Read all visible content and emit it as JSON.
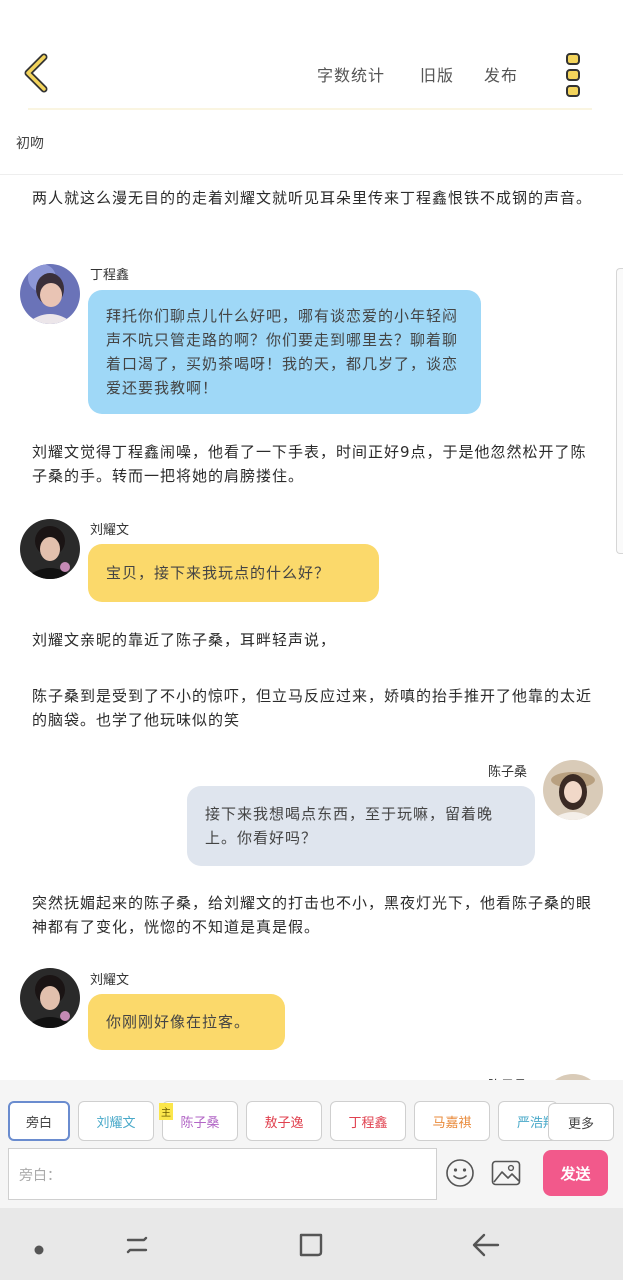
{
  "header": {
    "word_count_label": "字数统计",
    "old_version_label": "旧版",
    "publish_label": "发布"
  },
  "chapter_title": "初吻",
  "messages": [
    {
      "type": "narration",
      "text": "两人就这么漫无目的的走着刘耀文就听见耳朵里传来丁程鑫恨铁不成钢的声音。"
    },
    {
      "type": "dialogue",
      "speaker": "丁程鑫",
      "text": "拜托你们聊点儿什么好吧，哪有谈恋爱的小年轻闷声不吭只管走路的啊？你们要走到哪里去？聊着聊着口渴了，买奶茶喝呀！我的天，都几岁了，谈恋爱还要我教啊！"
    },
    {
      "type": "narration",
      "text": "刘耀文觉得丁程鑫闹噪，他看了一下手表，时间正好9点，于是他忽然松开了陈子桑的手。转而一把将她的肩膀搂住。"
    },
    {
      "type": "dialogue",
      "speaker": "刘耀文",
      "text": "宝贝，接下来我玩点的什么好？"
    },
    {
      "type": "narration",
      "text": "刘耀文亲昵的靠近了陈子桑，耳畔轻声说，"
    },
    {
      "type": "narration",
      "text": "陈子桑到是受到了不小的惊吓，但立马反应过来，娇嗔的抬手推开了他靠的太近的脑袋。也学了他玩味似的笑"
    },
    {
      "type": "dialogue",
      "speaker": "陈子桑",
      "text": "接下来我想喝点东西，至于玩嘛，留着晚上。你看好吗？"
    },
    {
      "type": "narration",
      "text": "突然抚媚起来的陈子桑，给刘耀文的打击也不小，黑夜灯光下，他看陈子桑的眼神都有了变化，恍惚的不知道是真是假。"
    },
    {
      "type": "dialogue",
      "speaker": "刘耀文",
      "text": "你刚刚好像在拉客。"
    },
    {
      "type": "dialogue",
      "speaker": "陈子桑",
      "text": ""
    }
  ],
  "roles": [
    {
      "label": "旁白",
      "color": "#444444",
      "active": true
    },
    {
      "label": "刘耀文",
      "color": "#49a9c9"
    },
    {
      "label": "陈子桑",
      "color": "#b266c6",
      "main_tag": "主"
    },
    {
      "label": "敖子逸",
      "color": "#e0414f"
    },
    {
      "label": "丁程鑫",
      "color": "#e0414f"
    },
    {
      "label": "马嘉祺",
      "color": "#e98a3a"
    },
    {
      "label": "严浩翔",
      "color": "#49a9c9"
    }
  ],
  "more_label": "更多",
  "input": {
    "placeholder": "旁白："
  },
  "send_label": "发送",
  "colors": {
    "accent_yellow": "#f3d45c",
    "bubble_blue": "#9fd8f7",
    "bubble_yellow": "#fbd96b",
    "bubble_gray": "#dfe5ee",
    "send_pink": "#f2598b"
  }
}
